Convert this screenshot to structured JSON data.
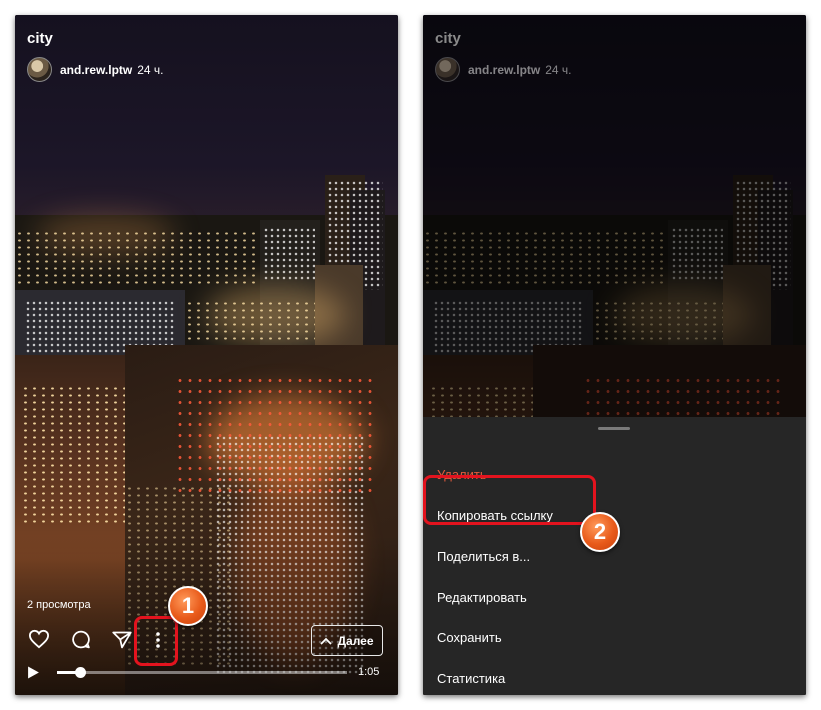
{
  "colors": {
    "highlight": "#e3131e",
    "badge": "#e85a1a",
    "delete_text": "#e05a3c",
    "sheet_bg": "#262626"
  },
  "story": {
    "title": "city",
    "author": "and.rew.lptw",
    "time": "24 ч.",
    "views": "2 просмотра",
    "next_label": "Далее",
    "duration": "1:05",
    "progress": 0.08
  },
  "icons": {
    "like": "heart-icon",
    "comment": "comment-icon",
    "share": "send-icon",
    "more": "more-vertical-icon",
    "play": "play-icon",
    "next": "chevron-up-icon"
  },
  "steps": {
    "step1": "1",
    "step2": "2"
  },
  "menu": {
    "items": [
      {
        "label": "Удалить"
      },
      {
        "label": "Копировать ссылку"
      },
      {
        "label": "Поделиться в..."
      },
      {
        "label": "Редактировать"
      },
      {
        "label": "Сохранить"
      },
      {
        "label": "Статистика"
      }
    ]
  }
}
